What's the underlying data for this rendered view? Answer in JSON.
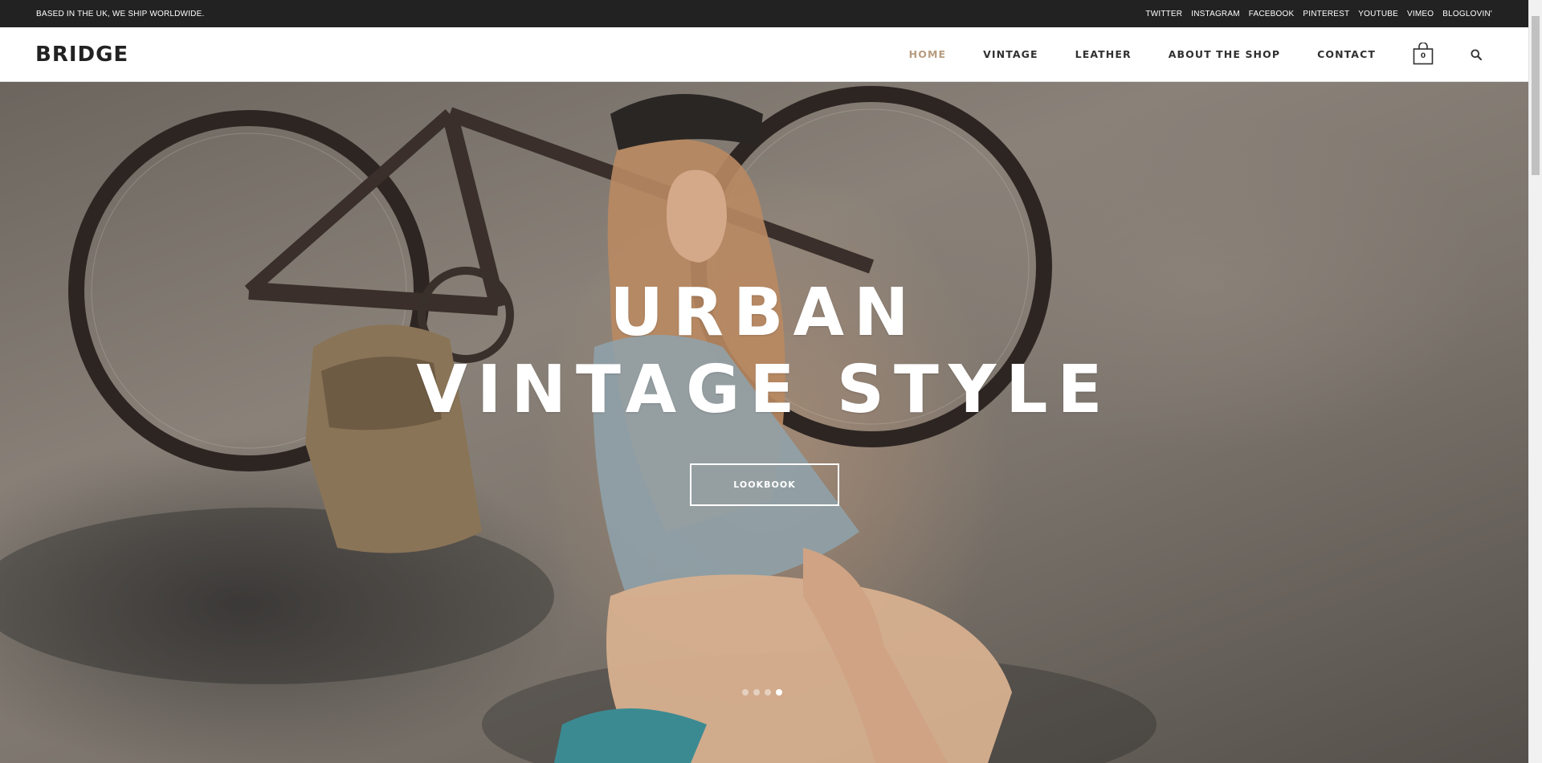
{
  "topbar": {
    "tagline": "BASED IN THE UK, WE SHIP WORLDWIDE.",
    "social_links": [
      "TWITTER",
      "INSTAGRAM",
      "FACEBOOK",
      "PINTEREST",
      "YOUTUBE",
      "VIMEO",
      "BLOGLOVIN'"
    ]
  },
  "header": {
    "logo": "BRIDGE",
    "nav": {
      "home": "HOME",
      "vintage": "VINTAGE",
      "leather": "LEATHER",
      "about": "ABOUT THE SHOP",
      "contact": "CONTACT"
    },
    "active_nav": "HOME",
    "cart_count": "0",
    "accent_color": "#b79c7f"
  },
  "hero": {
    "title_line1": "URBAN",
    "title_line2": "VINTAGE STYLE",
    "button_label": "LOOKBOOK",
    "slide_count": 4,
    "active_slide": 4
  },
  "icons": {
    "cart": "shopping-bag-icon",
    "search": "search-icon"
  }
}
